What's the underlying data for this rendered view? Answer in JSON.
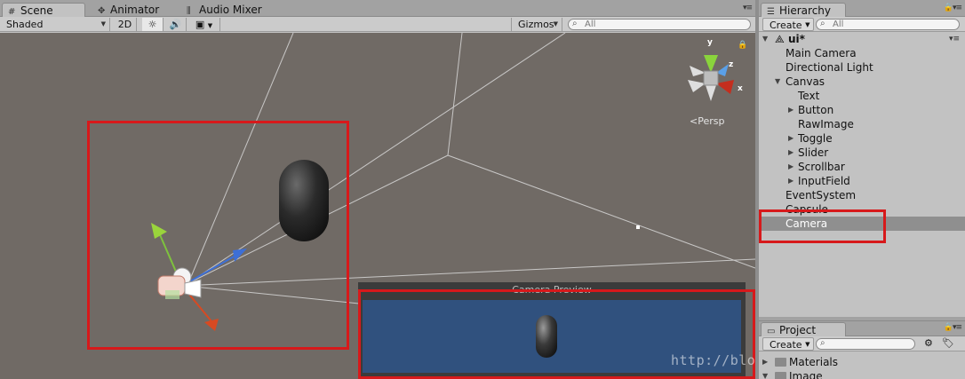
{
  "scene_panel": {
    "tabs": [
      {
        "label": "Scene",
        "icon": "grid-icon",
        "active": true
      },
      {
        "label": "Animator",
        "icon": "animator-icon",
        "active": false
      },
      {
        "label": "Audio Mixer",
        "icon": "audio-mixer-icon",
        "active": false
      }
    ],
    "toolbar": {
      "draw_mode": "Shaded",
      "mode_2d": "2D",
      "lighting_icon": "sun-icon",
      "audio_icon": "speaker-icon",
      "effects_icon": "image-icon",
      "gizmos": "Gizmos",
      "search_placeholder": "All"
    },
    "gizmo": {
      "y_label": "y",
      "z_label": "z",
      "x_label": "x",
      "projection": "Persp"
    },
    "camera_preview": {
      "title": "Camera Preview"
    },
    "colors": {
      "viewport": "#706a65",
      "highlight": "#d7191b",
      "preview_bg": "#30517e"
    }
  },
  "hierarchy": {
    "tab": "Hierarchy",
    "create_label": "Create",
    "search_placeholder": "All",
    "scene_name": "ui*",
    "items": [
      {
        "label": "Main Camera",
        "depth": 1,
        "foldout": false
      },
      {
        "label": "Directional Light",
        "depth": 1,
        "foldout": false
      },
      {
        "label": "Canvas",
        "depth": 1,
        "foldout": "open"
      },
      {
        "label": "Text",
        "depth": 2,
        "foldout": false
      },
      {
        "label": "Button",
        "depth": 2,
        "foldout": "closed"
      },
      {
        "label": "RawImage",
        "depth": 2,
        "foldout": false
      },
      {
        "label": "Toggle",
        "depth": 2,
        "foldout": "closed"
      },
      {
        "label": "Slider",
        "depth": 2,
        "foldout": "closed"
      },
      {
        "label": "Scrollbar",
        "depth": 2,
        "foldout": "closed"
      },
      {
        "label": "InputField",
        "depth": 2,
        "foldout": "closed"
      },
      {
        "label": "EventSystem",
        "depth": 1,
        "foldout": false
      },
      {
        "label": "Capsule",
        "depth": 1,
        "foldout": false
      },
      {
        "label": "Camera",
        "depth": 1,
        "foldout": false,
        "selected": true
      }
    ]
  },
  "project": {
    "tab": "Project",
    "create_label": "Create",
    "folders": [
      {
        "label": "Materials",
        "foldout": "closed"
      },
      {
        "label": "Image",
        "foldout": "open"
      }
    ]
  },
  "watermark": "http://blog.csdn.net/lilhertzberg"
}
